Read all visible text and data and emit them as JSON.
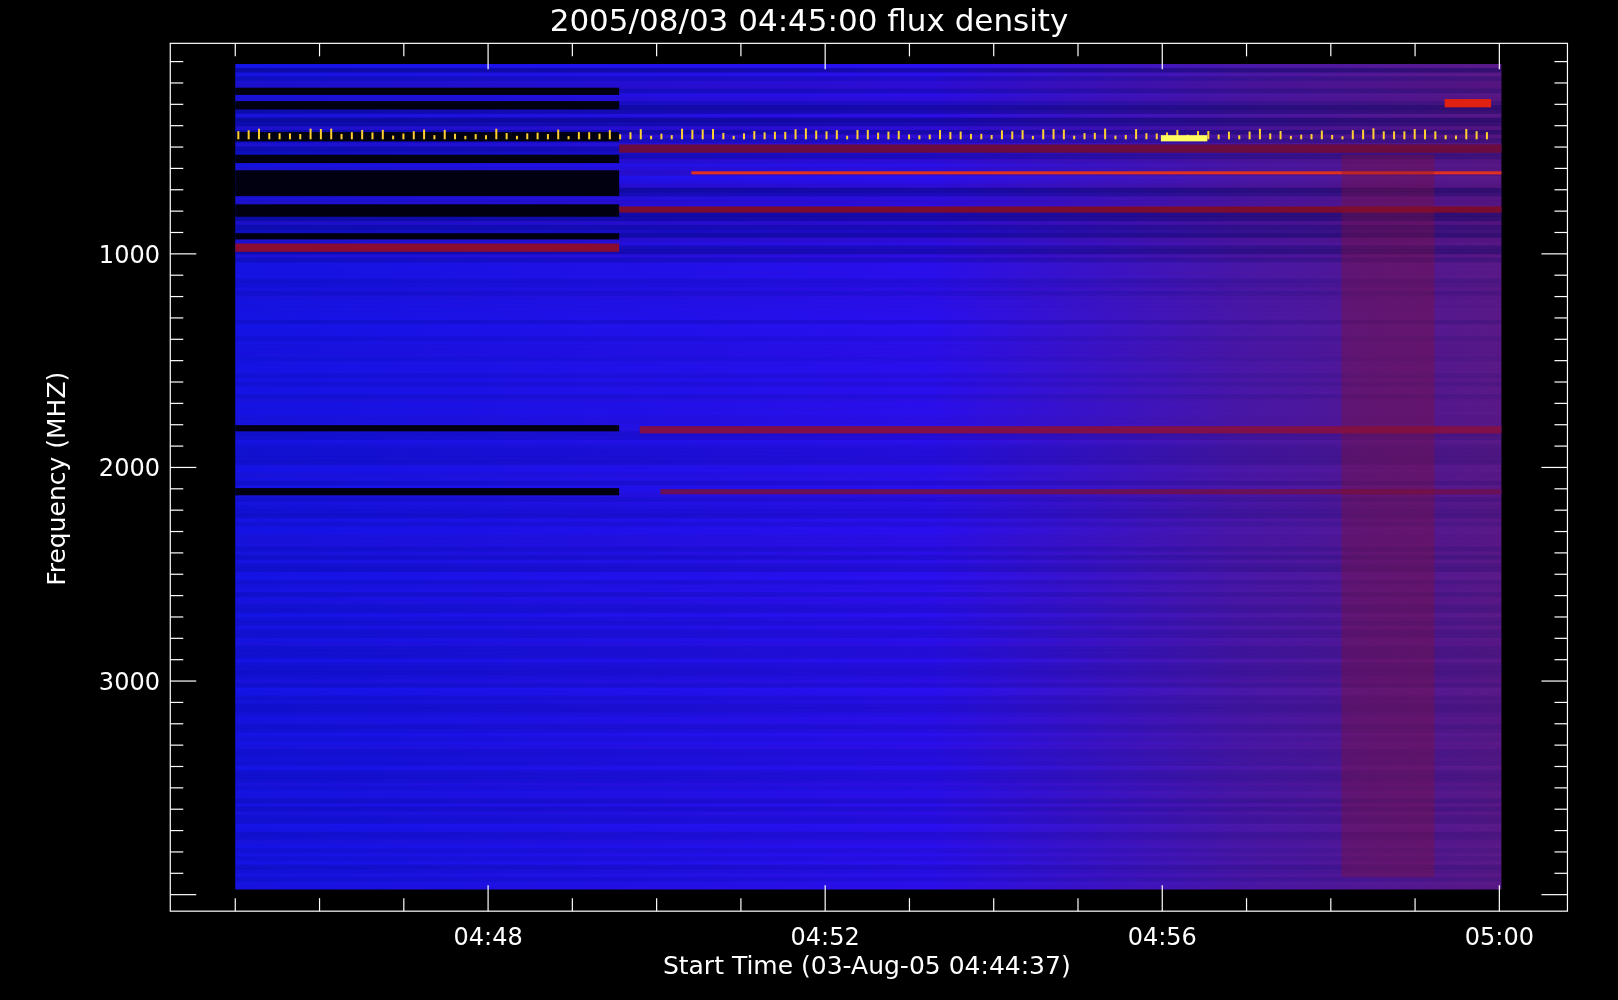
{
  "title": "2005/08/03 04:45:00 flux density",
  "plot": {
    "xlabel": "Start Time (03-Aug-05 04:44:37)",
    "ylabel": "Frequency (MHZ)",
    "xticks": [
      "04:48",
      "04:52",
      "04:56",
      "05:00"
    ],
    "yticks": [
      "1000",
      "2000",
      "3000"
    ]
  }
}
